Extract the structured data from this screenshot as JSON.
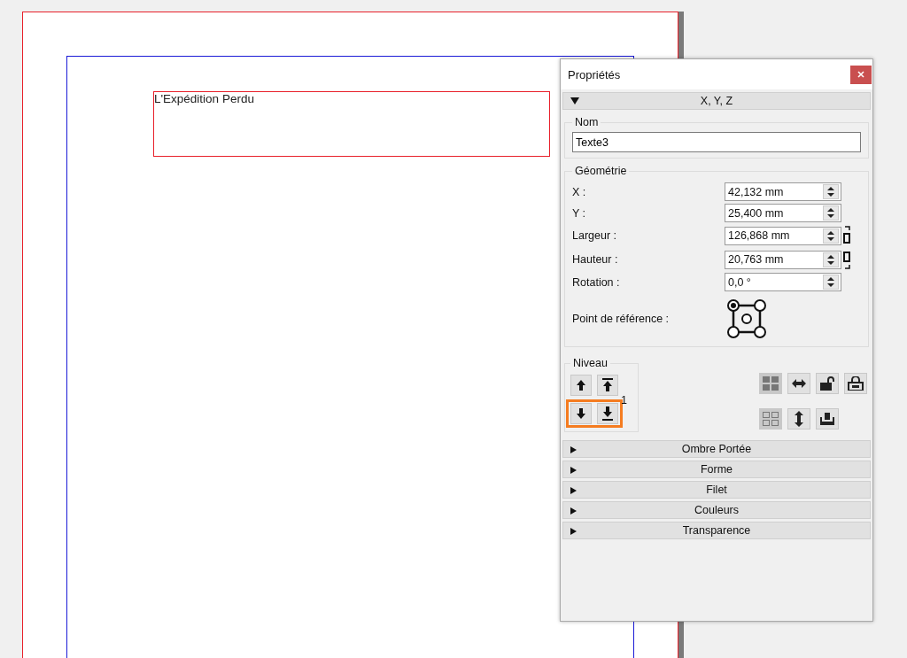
{
  "document": {
    "text_frame": "L'Expédition Perdu"
  },
  "panel": {
    "title": "Propriétés",
    "sections_top": [
      {
        "label": "X, Y, Z",
        "expanded": true
      }
    ],
    "name_group": {
      "legend": "Nom",
      "value": "Texte3"
    },
    "geometry": {
      "legend": "Géométrie",
      "fields": [
        {
          "label": "X :",
          "value": "42,132 mm",
          "linked": false
        },
        {
          "label": "Y :",
          "value": "25,400 mm",
          "linked": false
        },
        {
          "label": "Largeur :",
          "value": "126,868 mm",
          "linked": true
        },
        {
          "label": "Hauteur :",
          "value": "20,763 mm",
          "linked": true
        },
        {
          "label": "Rotation :",
          "value": "0,0 °",
          "linked": false
        }
      ],
      "reference_label": "Point de référence :",
      "reference_points": [
        {
          "kind": "top-left",
          "selected": true
        },
        {
          "kind": "top-right",
          "selected": false
        },
        {
          "kind": "center",
          "selected": false
        },
        {
          "kind": "bottom-left",
          "selected": false
        },
        {
          "kind": "bottom-right",
          "selected": false
        }
      ]
    },
    "level": {
      "legend": "Niveau",
      "value": "1",
      "rows": [
        {
          "highlighted": false,
          "buttons": [
            {
              "kind": "up"
            },
            {
              "kind": "top"
            }
          ]
        },
        {
          "highlighted": true,
          "buttons": [
            {
              "kind": "down"
            },
            {
              "kind": "bottom"
            }
          ]
        }
      ]
    },
    "tools": [
      [
        {
          "kind": "group",
          "pressed": true
        },
        {
          "kind": "flip-h",
          "pressed": false
        },
        {
          "kind": "lock",
          "pressed": false
        },
        {
          "kind": "unlock",
          "pressed": false
        }
      ],
      [
        {
          "kind": "ungroup",
          "pressed": true
        },
        {
          "kind": "flip-v",
          "pressed": false
        },
        {
          "kind": "stamp",
          "pressed": false
        }
      ]
    ],
    "sections": [
      {
        "label": "Ombre Portée",
        "expanded": false
      },
      {
        "label": "Forme",
        "expanded": false
      },
      {
        "label": "Filet",
        "expanded": false
      },
      {
        "label": "Couleurs",
        "expanded": false
      },
      {
        "label": "Transparence",
        "expanded": false
      }
    ]
  }
}
